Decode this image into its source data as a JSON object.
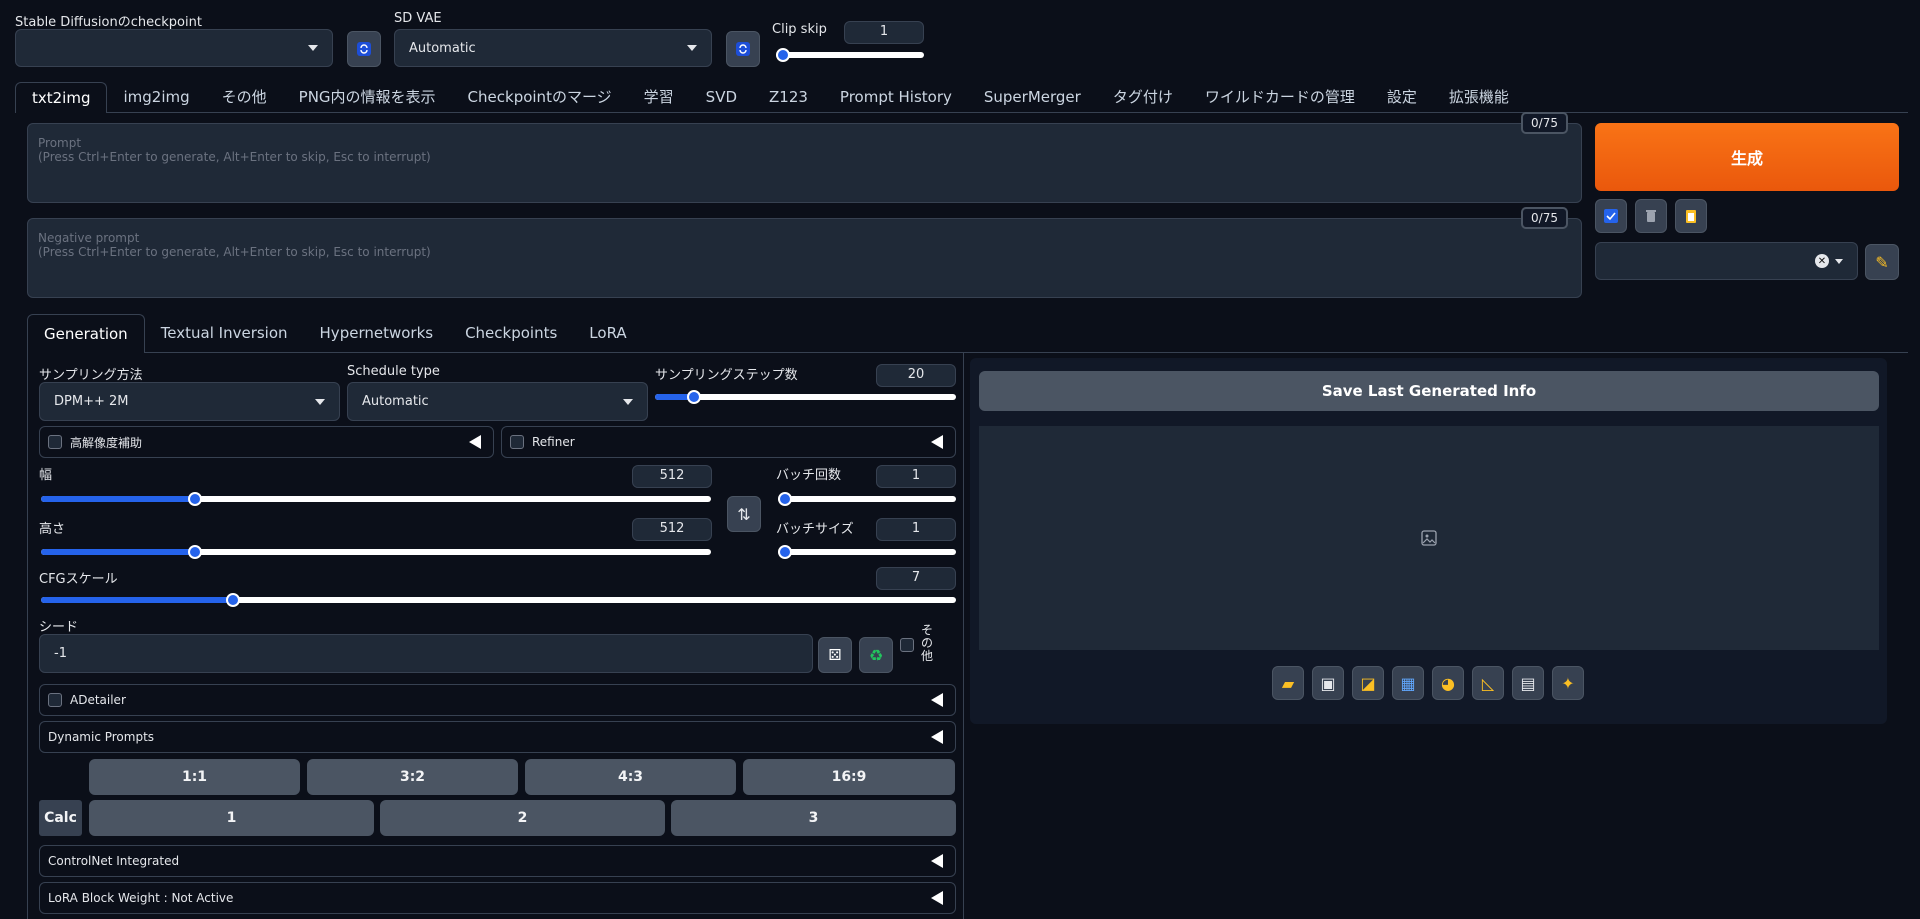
{
  "top": {
    "checkpoint_label": "Stable Diffusionのcheckpoint",
    "checkpoint_value": "",
    "vae_label": "SD VAE",
    "vae_value": "Automatic",
    "clip_skip_label": "Clip skip",
    "clip_skip_value": "1",
    "clip_skip_fraction": 0.0
  },
  "main_tabs": [
    "txt2img",
    "img2img",
    "その他",
    "PNG内の情報を表示",
    "Checkpointのマージ",
    "学習",
    "SVD",
    "Z123",
    "Prompt History",
    "SuperMerger",
    "タグ付け",
    "ワイルドカードの管理",
    "設定",
    "拡張機能"
  ],
  "prompt": {
    "placeholder_line1": "Prompt",
    "placeholder_line2": "(Press Ctrl+Enter to generate, Alt+Enter to skip, Esc to interrupt)",
    "counter": "0/75"
  },
  "negative_prompt": {
    "placeholder_line1": "Negative prompt",
    "placeholder_line2": "(Press Ctrl+Enter to generate, Alt+Enter to skip, Esc to interrupt)",
    "counter": "0/75"
  },
  "generate_label": "生成",
  "sub_tabs": [
    "Generation",
    "Textual Inversion",
    "Hypernetworks",
    "Checkpoints",
    "LoRA"
  ],
  "sampling": {
    "method_label": "サンプリング方法",
    "method_value": "DPM++ 2M",
    "schedule_label": "Schedule type",
    "schedule_value": "Automatic",
    "steps_label": "サンプリングステップ数",
    "steps_value": "20",
    "steps_fraction": 0.13
  },
  "hires_label": "高解像度補助",
  "refiner_label": "Refiner",
  "width": {
    "label": "幅",
    "value": "512",
    "fraction": 0.23
  },
  "height": {
    "label": "高さ",
    "value": "512",
    "fraction": 0.23
  },
  "batch_count": {
    "label": "バッチ回数",
    "value": "1",
    "fraction": 0.0
  },
  "batch_size": {
    "label": "バッチサイズ",
    "value": "1",
    "fraction": 0.0
  },
  "cfg": {
    "label": "CFGスケール",
    "value": "7",
    "fraction": 0.21
  },
  "seed": {
    "label": "シード",
    "value": "-1",
    "extra_label": "その他"
  },
  "adetailer_label": "ADetailer",
  "dynamic_prompts_label": "Dynamic Prompts",
  "ratios": [
    "1:1",
    "3:2",
    "4:3",
    "16:9"
  ],
  "calc_label": "Calc",
  "calc_buttons": [
    "1",
    "2",
    "3"
  ],
  "controlnet_label": "ControlNet Integrated",
  "lora_block_label": "LoRA Block Weight : Not Active",
  "save_info_label": "Save Last Generated Info",
  "colors": {
    "generate": "#f97316",
    "accent": "#2563eb",
    "bg": "#0b0f19"
  }
}
